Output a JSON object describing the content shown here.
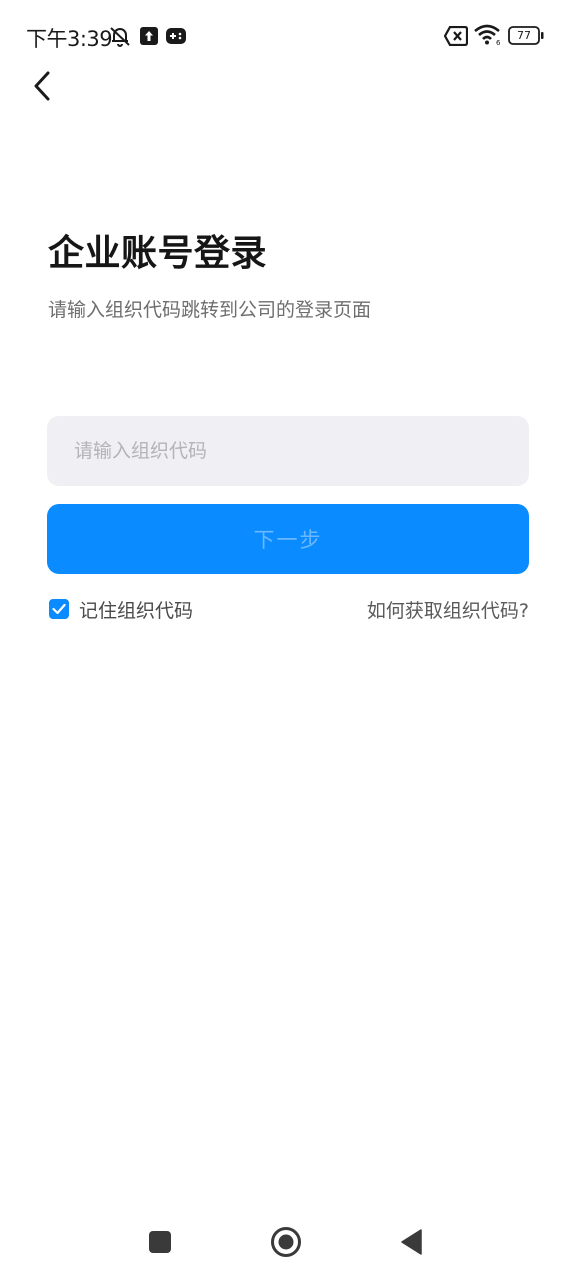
{
  "status_bar": {
    "time": "下午3:39",
    "battery": "77",
    "icons": [
      "notifications-muted-icon",
      "upload-icon",
      "gamepad-icon",
      "no-sim-icon",
      "wifi-icon",
      "battery-icon"
    ]
  },
  "header": {
    "back_icon": "chevron-left-icon"
  },
  "main": {
    "title": "企业账号登录",
    "subtitle": "请输入组织代码跳转到公司的登录页面",
    "org_code_input": {
      "value": "",
      "placeholder": "请输入组织代码"
    },
    "next_button_label": "下一步",
    "remember_label": "记住组织代码",
    "remember_checked": true,
    "help_link": "如何获取组织代码?"
  },
  "colors": {
    "accent": "#0a8bff",
    "input_bg": "#f0f0f4",
    "button_text_disabled": "#6cb8ff"
  },
  "nav_bar": {
    "icons": [
      "recents-square-icon",
      "home-circle-icon",
      "back-triangle-icon"
    ]
  }
}
